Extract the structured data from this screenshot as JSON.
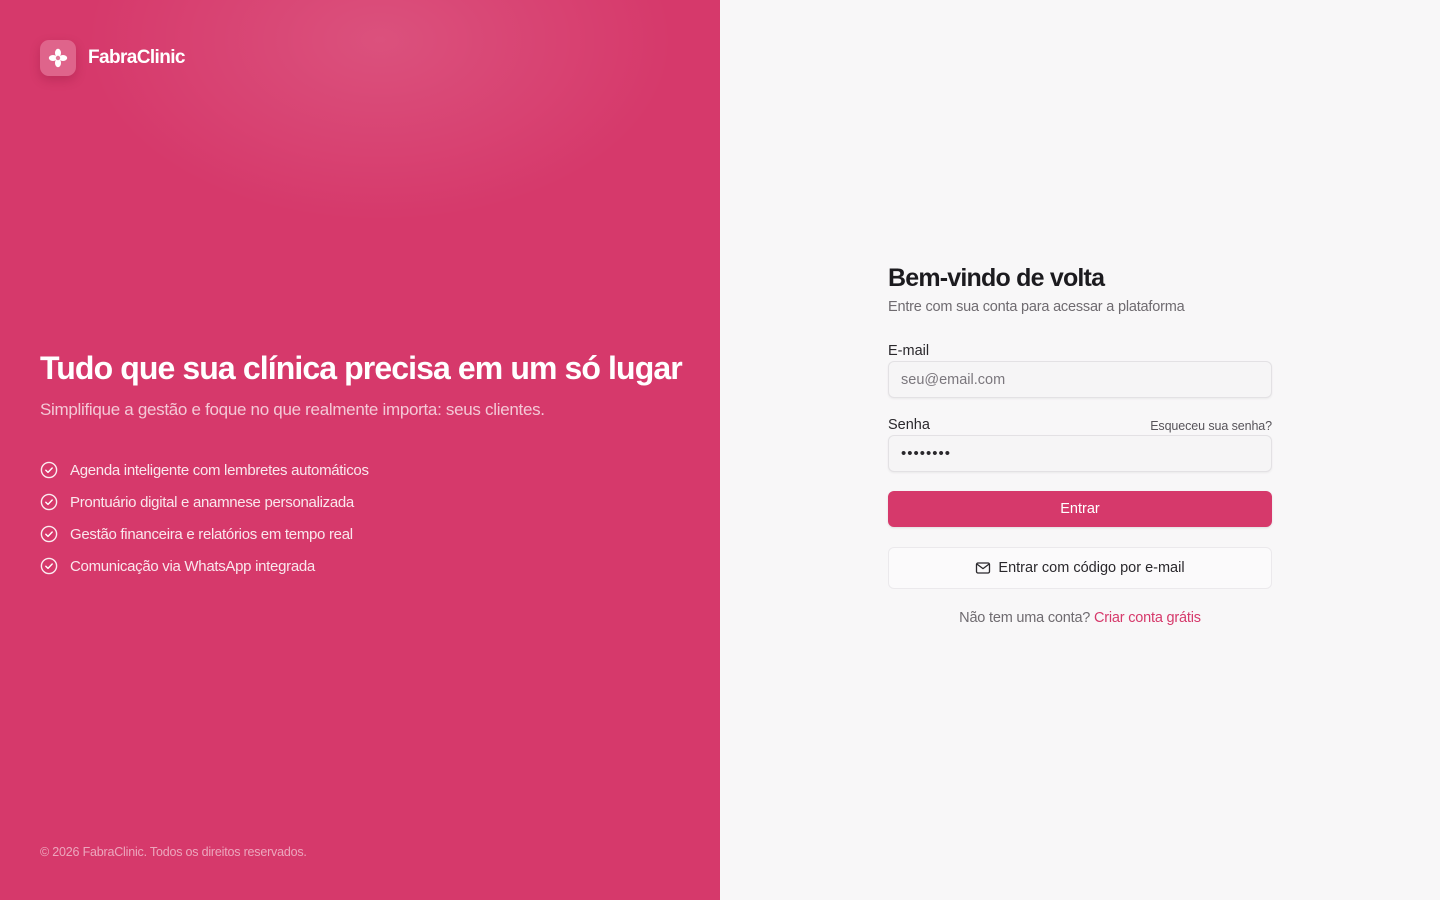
{
  "brand": {
    "name": "FabraClinic",
    "logo_icon": "flower-icon"
  },
  "hero": {
    "title": "Tudo que sua clínica precisa em um só lugar",
    "subtitle": "Simplifique a gestão e foque no que realmente importa: seus clientes.",
    "features": [
      "Agenda inteligente com lembretes automáticos",
      "Prontuário digital e anamnese personalizada",
      "Gestão financeira e relatórios em tempo real",
      "Comunicação via WhatsApp integrada"
    ],
    "feature_icon": "check-circle-icon"
  },
  "footer": {
    "copyright": "© 2026 FabraClinic. Todos os direitos reservados."
  },
  "login": {
    "title": "Bem-vindo de volta",
    "description": "Entre com sua conta para acessar a plataforma",
    "email_label": "E-mail",
    "email_placeholder": "seu@email.com",
    "password_label": "Senha",
    "forgot_password": "Esqueceu sua senha?",
    "password_value": "••••••••",
    "submit_label": "Entrar",
    "code_login_label": "Entrar com código por e-mail",
    "code_login_icon": "mail-icon",
    "no_account_text": "Não tem uma conta?",
    "signup_link": "Criar conta grátis"
  },
  "colors": {
    "brand": "#d6396b",
    "background": "#f8f7f8"
  }
}
